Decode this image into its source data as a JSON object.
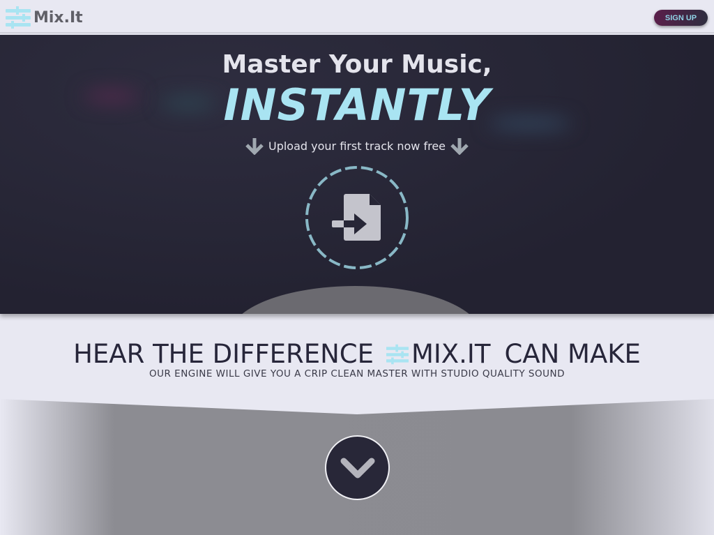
{
  "nav": {
    "brand": "Mix.It",
    "signup_label": "SIGN UP"
  },
  "hero": {
    "title": "Master Your Music,",
    "highlight": "INSTANTLY",
    "subtitle": "Upload your first track now free",
    "upload_icon": "file-import-icon"
  },
  "difference": {
    "title_before": "HEAR THE DIFFERENCE",
    "brand": "MIX.IT",
    "title_after": "CAN MAKE",
    "subtitle": "OUR ENGINE WILL GIVE YOU A CRIP CLEAN MASTER WITH STUDIO QUALITY SOUND"
  },
  "colors": {
    "accent": "#a9e4f2",
    "dark": "#272636"
  }
}
